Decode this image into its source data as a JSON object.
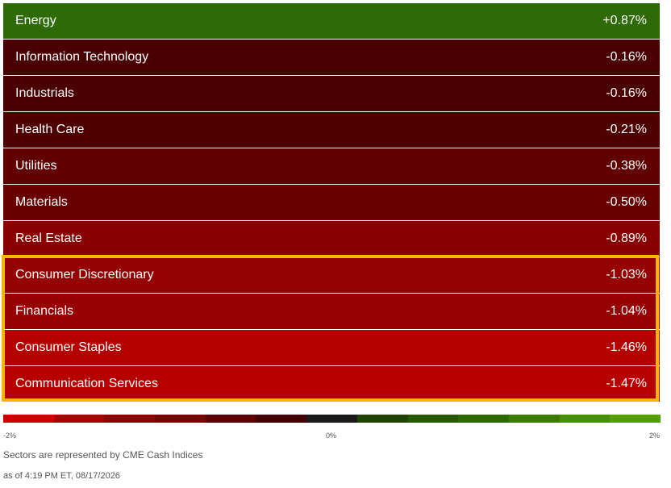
{
  "sectors": [
    {
      "name": "Energy",
      "change": "+0.87%",
      "color": "#2e6b06"
    },
    {
      "name": "Information Technology",
      "change": "-0.16%",
      "color": "#4a0000"
    },
    {
      "name": "Industrials",
      "change": "-0.16%",
      "color": "#4a0000"
    },
    {
      "name": "Health Care",
      "change": "-0.21%",
      "color": "#4f0000"
    },
    {
      "name": "Utilities",
      "change": "-0.38%",
      "color": "#600000"
    },
    {
      "name": "Materials",
      "change": "-0.50%",
      "color": "#680000"
    },
    {
      "name": "Real Estate",
      "change": "-0.89%",
      "color": "#880000"
    },
    {
      "name": "Consumer Discretionary",
      "change": "-1.03%",
      "color": "#950000"
    },
    {
      "name": "Financials",
      "change": "-1.04%",
      "color": "#960000"
    },
    {
      "name": "Consumer Staples",
      "change": "-1.46%",
      "color": "#b50000"
    },
    {
      "name": "Communication Services",
      "change": "-1.47%",
      "color": "#b60000"
    }
  ],
  "scale": {
    "min_label": "-2%",
    "mid_label": "0%",
    "max_label": "2%",
    "colors": [
      "#cc0000",
      "#aa0000",
      "#900000",
      "#780000",
      "#5e0000",
      "#440000",
      "#1a1a1a",
      "#1e4400",
      "#265800",
      "#2e6800",
      "#3a7c00",
      "#469000",
      "#52a000"
    ]
  },
  "footer": {
    "source_note": "Sectors are represented by CME Cash Indices",
    "timestamp": "as of 4:19 PM ET, 08/17/2026"
  }
}
